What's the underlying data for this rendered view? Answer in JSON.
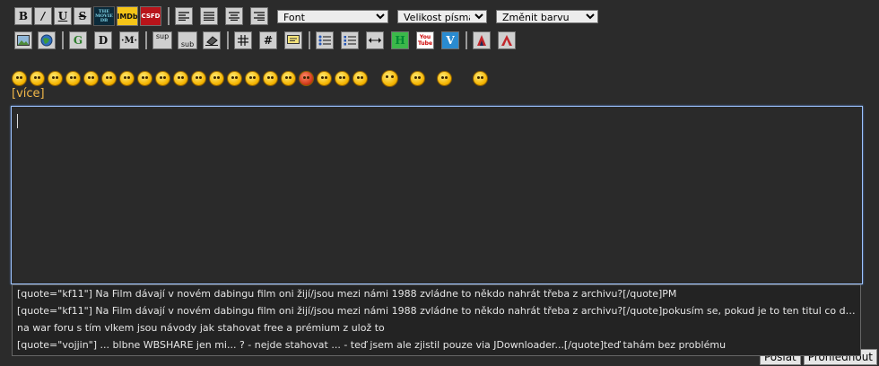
{
  "toolbar1": {
    "bold": "B",
    "italic": "/",
    "underline": "U",
    "strike": "S",
    "tmdb": "THE MOVIE DB",
    "imdb": "IMDb",
    "csfd": "CSFD",
    "font_select": "Font",
    "size_select": "Velikost písma",
    "color_select": "Změnit barvu"
  },
  "toolbar2": {
    "google": "G",
    "d": "D",
    "m": "·M·",
    "sup": "sup",
    "sub": "sub",
    "hash": "#",
    "h": "H",
    "youtube": "You Tube",
    "v": "V"
  },
  "more_link": "[více]",
  "autocomplete": [
    "[quote=\"kf11\"] Na Film dávají v novém dabingu film oni žijí/jsou mezi námi 1988 zvládne to někdo nahrát třeba z archivu?[/quote]PM",
    "[quote=\"kf11\"] Na Film dávají v novém dabingu film oni žijí/jsou mezi námi 1988 zvládne to někdo nahrát třeba z archivu?[/quote]pokusím se, pokud je to ten titul co dávají ve ...",
    "na war foru s tím vlkem jsou návody jak stahovat free a prémium z ulož to",
    "[quote=\"vojjin\"] ... blbne WBSHARE jen mi... ? - nejde stahovat ... - teď jsem ale zjistil pouze via JDownloader...[/quote]teď tahám bez problému"
  ],
  "buttons": {
    "send": "Poslat",
    "preview": "Prohlédnout"
  }
}
